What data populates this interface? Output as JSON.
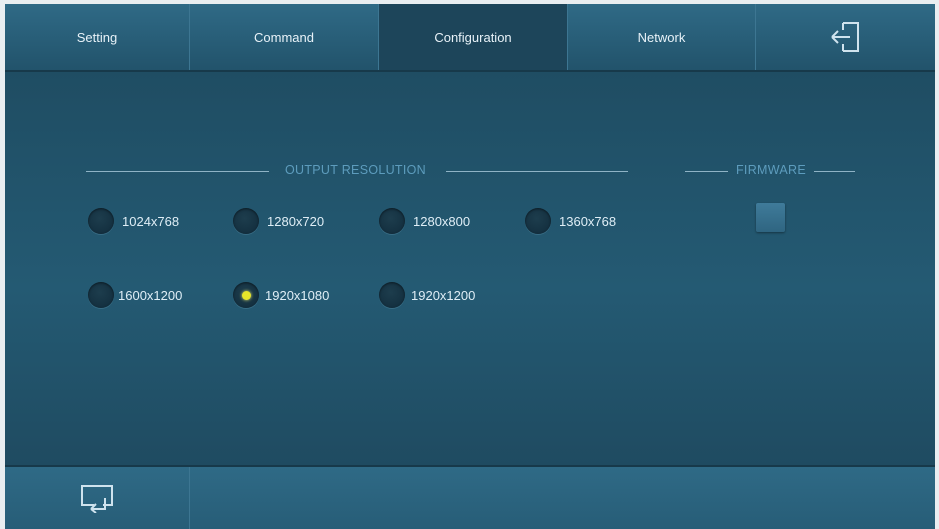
{
  "tabs": [
    {
      "label": "Setting",
      "active": false
    },
    {
      "label": "Command",
      "active": false
    },
    {
      "label": "Configuration",
      "active": true
    },
    {
      "label": "Network",
      "active": false
    }
  ],
  "exit_icon": "exit-door-icon",
  "output_resolution": {
    "title": "OUTPUT RESOLUTION",
    "selected": "1920x1080",
    "options": [
      "1024x768",
      "1280x720",
      "1280x800",
      "1360x768",
      "1600x1200",
      "1920x1080",
      "1920x1200"
    ]
  },
  "firmware": {
    "title": "FIRMWARE"
  },
  "bottom": {
    "back_icon": "return-icon"
  },
  "colors": {
    "accent_dot": "#e6e62a",
    "section_title": "#5d9cbd",
    "background": "#1f4d63"
  }
}
